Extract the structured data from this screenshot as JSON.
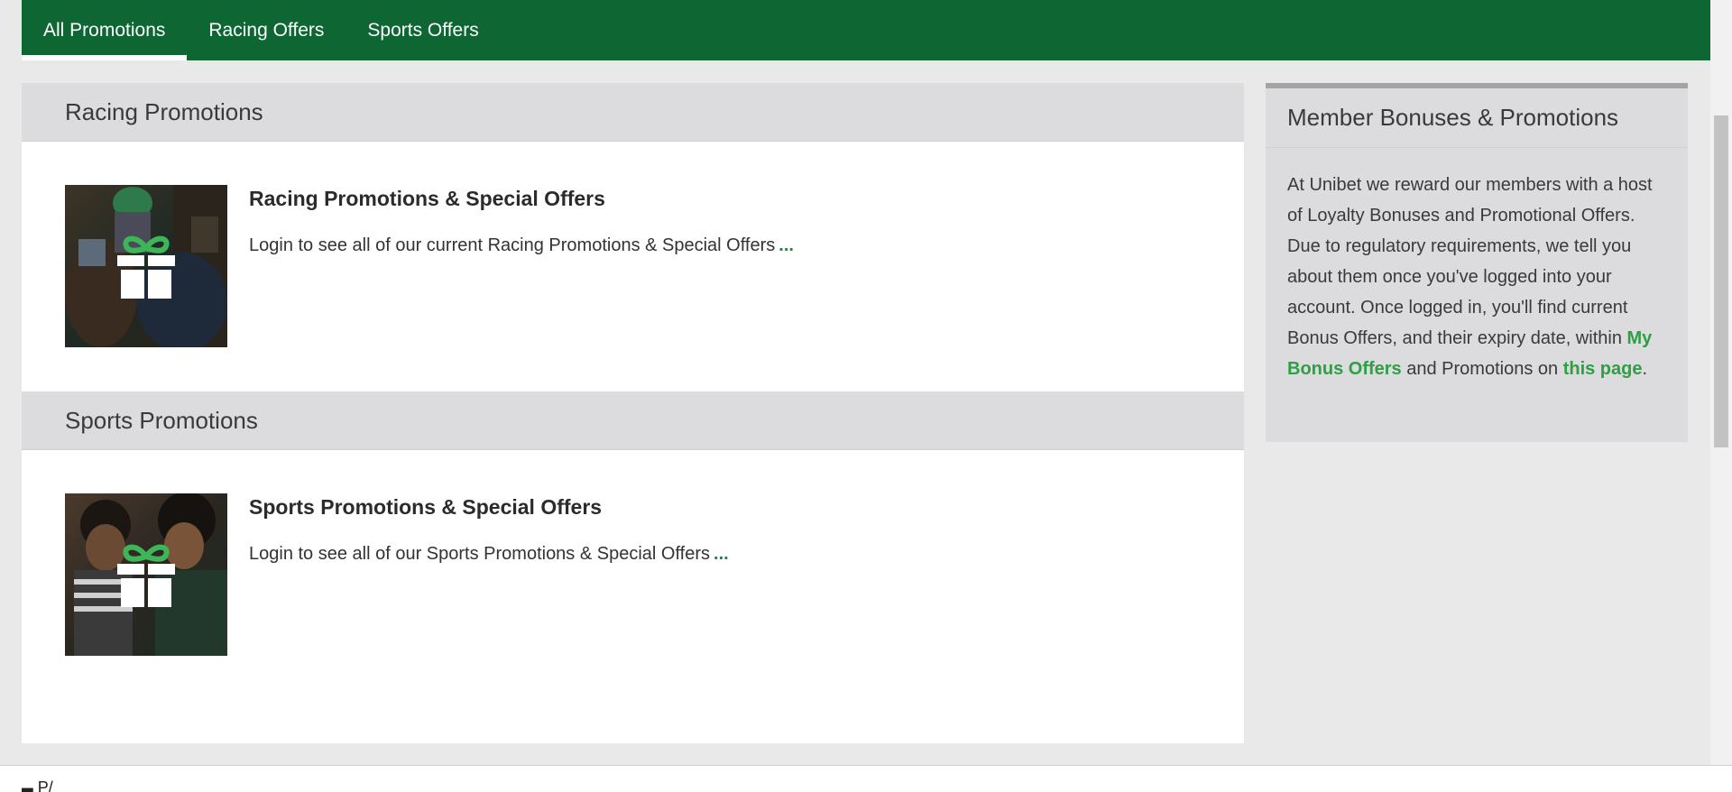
{
  "nav": {
    "tabs": [
      {
        "label": "All Promotions",
        "active": true
      },
      {
        "label": "Racing Offers",
        "active": false
      },
      {
        "label": "Sports Offers",
        "active": false
      }
    ]
  },
  "sections": [
    {
      "header": "Racing Promotions",
      "promo": {
        "title": "Racing Promotions & Special Offers",
        "description": "Login to see all of our current Racing Promotions & Special Offers",
        "more": "...",
        "thumbnail_icon": "gift-icon"
      }
    },
    {
      "header": "Sports Promotions",
      "promo": {
        "title": "Sports Promotions & Special Offers",
        "description": "Login to see all of our Sports Promotions & Special Offers",
        "more": "...",
        "thumbnail_icon": "gift-icon"
      }
    }
  ],
  "sidebar": {
    "title": "Member Bonuses & Promotions",
    "body_before": "At Unibet we reward our members with a host of Loyalty Bonuses and Promotional Offers. Due to regulatory requirements, we tell you about them once you've logged into your account. Once logged in, you'll find current Bonus Offers, and their expiry date, within ",
    "link1": "My Bonus Offers",
    "body_middle": " and Promotions on ",
    "link2": "this page",
    "body_after": "."
  },
  "bottom_strip": {
    "glyphs": "▄ P/"
  },
  "colors": {
    "nav_bg": "#0e6633",
    "accent_green": "#2f9e44",
    "gift_green": "#3fb55a",
    "header_bg": "#dcdbdd",
    "page_bg": "#e9e9e9"
  }
}
